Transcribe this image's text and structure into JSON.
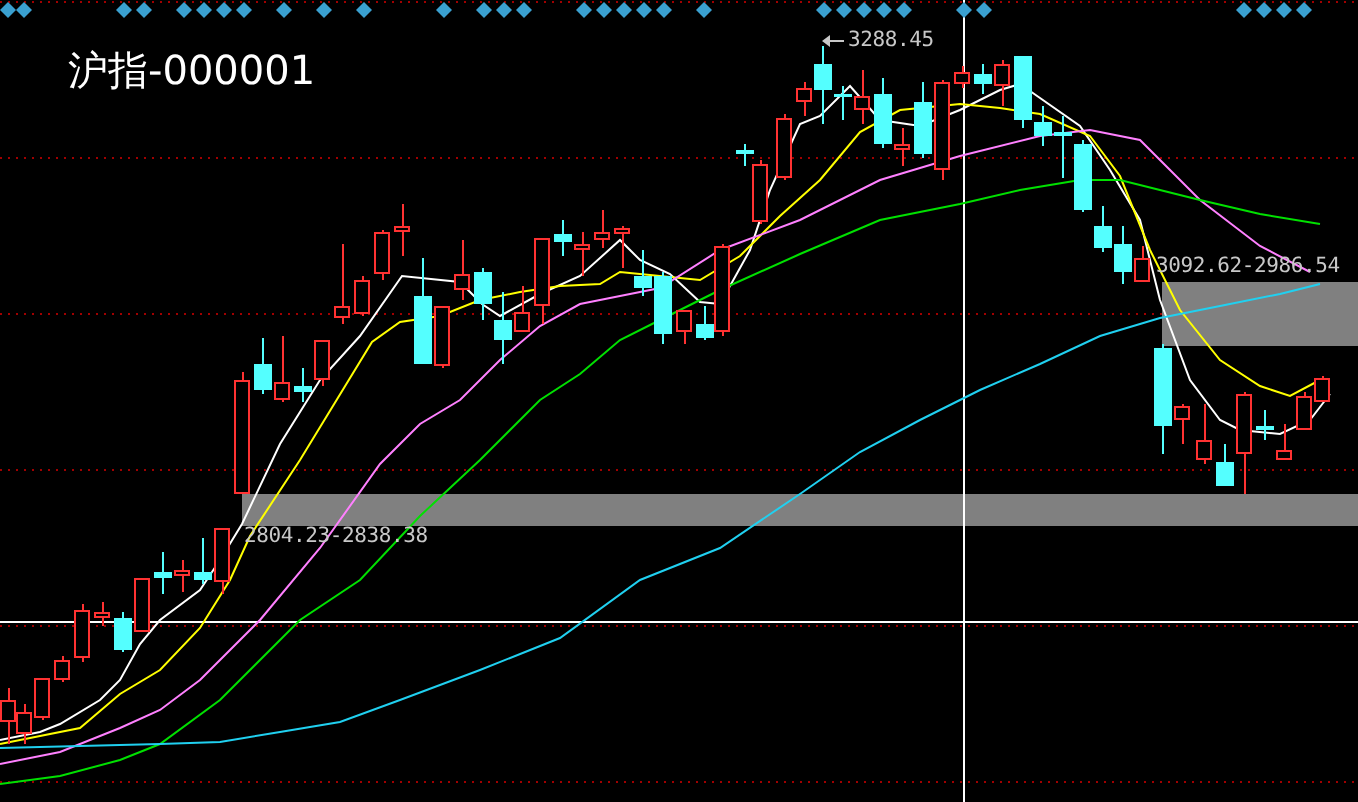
{
  "title": "沪指-000001",
  "annotations": [
    {
      "kind": "peak",
      "text": "3288.45"
    },
    {
      "kind": "zone",
      "text": "2804.23-2838.38"
    },
    {
      "kind": "zone",
      "text": "3092.62-2986.54"
    }
  ]
}
